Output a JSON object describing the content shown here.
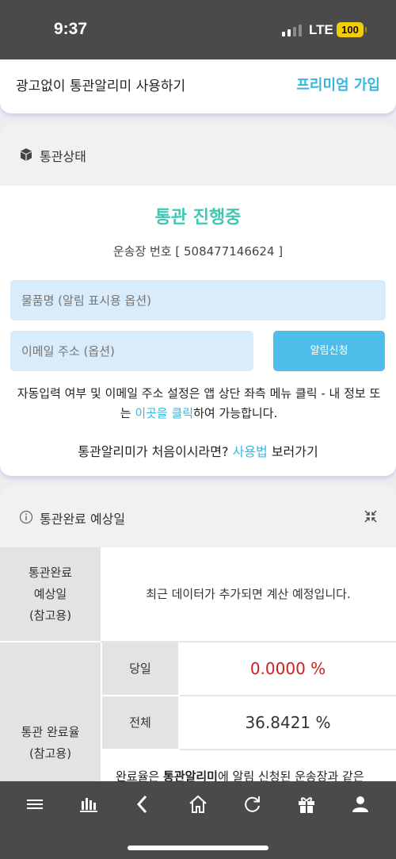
{
  "status_bar": {
    "time": "9:37",
    "network": "LTE",
    "battery": "100",
    "battery_color": "#f2cd0c"
  },
  "premium_bar": {
    "text": "광고없이 통관알리미 사용하기",
    "link": "프리미엄 가입"
  },
  "customs_status": {
    "section_title": "통관상태",
    "status_text": "통관 진행중",
    "tracking_number": "운송장 번호 [ 508477146624 ]",
    "item_name_placeholder": "물품명 (알림 표시용 옵션)",
    "email_placeholder": "이메일 주소 (옵션)",
    "alert_button": "알림신청",
    "note_part1": "자동입력 여부 및 이메일 주소 설정은 앱 상단 좌측 메뉴 클릭 - 내 정보 또는 ",
    "note_link": "이곳을 클릭",
    "note_part2": "하여 가능합니다.",
    "intro_part1": "통관알리미가 처음이시라면? ",
    "intro_link": "사용법",
    "intro_part2": " 보러가기",
    "accent_color": "#3fc7b3",
    "link_color": "#36b7e0"
  },
  "completion": {
    "section_title": "통관완료 예상일",
    "est_label": [
      "통관완료",
      "예상일",
      "(참고용)"
    ],
    "est_value": "최근 데이터가 추가되면 계산 예정입니다.",
    "rate_label": [
      "통관 완료율",
      "(참고용)"
    ],
    "rows": [
      {
        "label": "당일",
        "value": "0.0000 %",
        "color": "#cc1f1f"
      },
      {
        "label": "전체",
        "value": "36.8421 %",
        "color": "#333333"
      }
    ],
    "footnote_part1": "완료율은 ",
    "footnote_bold": "통관알리미",
    "footnote_part2": "에 알림 신청된 운송장과 같은"
  },
  "bottom_nav": {
    "icons": [
      "menu-icon",
      "chart-icon",
      "back-icon",
      "home-icon",
      "refresh-icon",
      "gift-icon",
      "user-icon"
    ]
  }
}
